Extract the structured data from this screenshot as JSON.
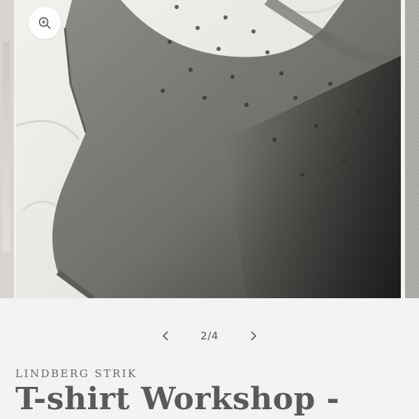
{
  "gallery": {
    "image_alt": "Grey knitted t-shirt with lace yoke",
    "zoom_icon": "zoom-in-icon"
  },
  "pager": {
    "prev_icon": "chevron-left-icon",
    "next_icon": "chevron-right-icon",
    "counter": "2/4"
  },
  "product": {
    "vendor": "LINDBERG STRIK",
    "title": "T-shirt Workshop -"
  },
  "colors": {
    "background": "#f3f3f3",
    "text": "#5a5a5a",
    "garment": "#7d7f78"
  }
}
